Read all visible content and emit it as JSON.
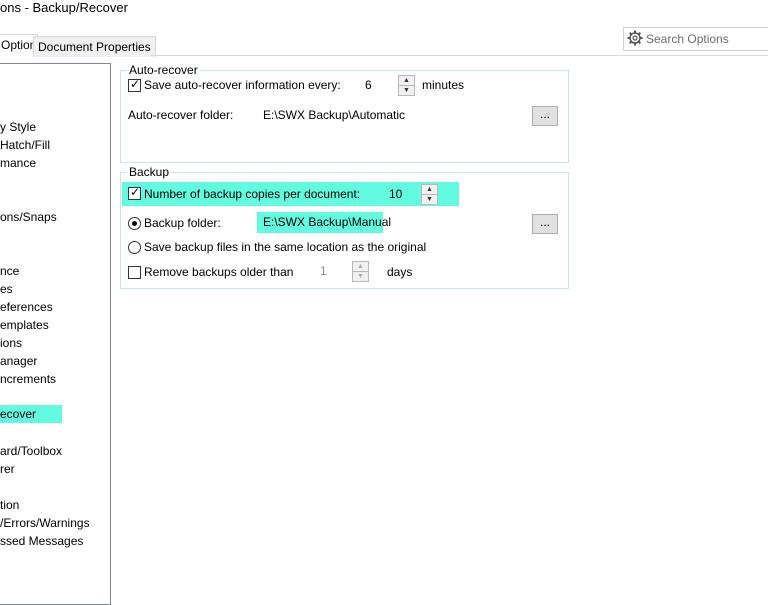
{
  "window": {
    "title": "ons - Backup/Recover"
  },
  "tabs": [
    {
      "label": "Options"
    },
    {
      "label": "Document Properties"
    }
  ],
  "search": {
    "placeholder": "Search Options",
    "icon": "gear-icon"
  },
  "tree": {
    "items": [
      "y Style",
      "Hatch/Fill",
      "mance",
      "ons/Snaps",
      "nce",
      "es",
      "eferences",
      "emplates",
      "ions",
      "anager",
      "ncrements",
      "ecover",
      "ard/Toolbox",
      "rer",
      "tion",
      "/Errors/Warnings",
      "ssed Messages"
    ],
    "selected": "ecover"
  },
  "auto_recover": {
    "group_title": "Auto-recover",
    "save_label": "Save auto-recover information every:",
    "save_checked": true,
    "interval": "6",
    "interval_unit": "minutes",
    "folder_label": "Auto-recover folder:",
    "folder_value": "E:\\SWX Backup\\Automatic",
    "browse_label": "..."
  },
  "backup": {
    "group_title": "Backup",
    "copies_label": "Number of backup copies per document:",
    "copies_checked": true,
    "copies_value": "10",
    "folder_option_label": "Backup folder:",
    "folder_value": "E:\\SWX Backup\\Manual",
    "same_location_label": "Save backup files in the same location as the original",
    "selected_option": "Backup folder",
    "browse_label": "...",
    "remove_label": "Remove backups older than",
    "remove_checked": false,
    "remove_value": "1",
    "remove_unit": "days"
  },
  "colors": {
    "highlight": "#62fbe0",
    "group_border": "#d5dfe5"
  }
}
